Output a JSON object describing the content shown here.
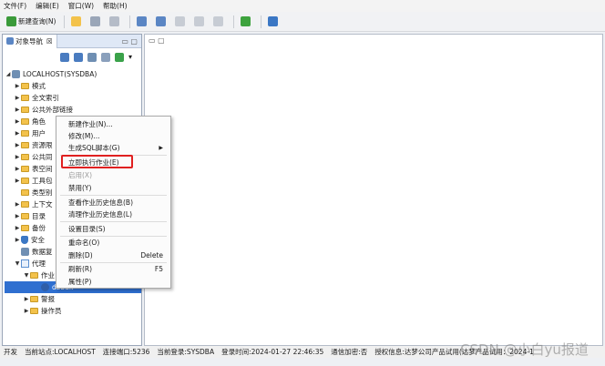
{
  "menubar": [
    "文件(F)",
    "编辑(E)",
    "窗口(W)",
    "帮助(H)"
  ],
  "toolbar": {
    "new_query_label": "新建查询(N)"
  },
  "left_pane": {
    "tab_title": "对象导航",
    "tab_close": "☒",
    "ctrls": "▭ ▢"
  },
  "tree": {
    "root": "LOCALHOST(SYSDBA)",
    "items": [
      "模式",
      "全文索引",
      "公共外部链接",
      "角色",
      "用户",
      "资源限",
      "公共同",
      "表空间",
      "工具包",
      "类型别",
      "上下文",
      "目录",
      "备份",
      "安全",
      "数据复",
      "代理",
      "作业",
      "dbbak",
      "警报",
      "操作员"
    ]
  },
  "context_menu": {
    "items": [
      "新建作业(N)...",
      "修改(M)...",
      "生成SQL脚本(G)",
      "立即执行作业(E)",
      "启用(X)",
      "禁用(Y)",
      "查看作业历史信息(B)",
      "清理作业历史信息(L)",
      "设置目录(S)",
      "重命名(O)",
      "删除(D)",
      "刷新(R)",
      "属性(P)"
    ],
    "delete_shortcut": "Delete",
    "refresh_shortcut": "F5",
    "submenu_arrow": "▶"
  },
  "status": {
    "mode": "开发",
    "site": "当前站点:LOCALHOST",
    "port": "连接端口:5236",
    "login": "当前登录:SYSDBA",
    "login_time": "登录时间:2024-01-27 22:46:35",
    "encrypt": "通信加密:否",
    "license": "授权信息:达梦公司产品试用(达梦产品试用：2024-1"
  },
  "watermark": "CSDN @小白yu报道",
  "colors": {
    "selection": "#2f6fd0",
    "highlight_border": "#e02020",
    "folder": "#f3c24b"
  }
}
